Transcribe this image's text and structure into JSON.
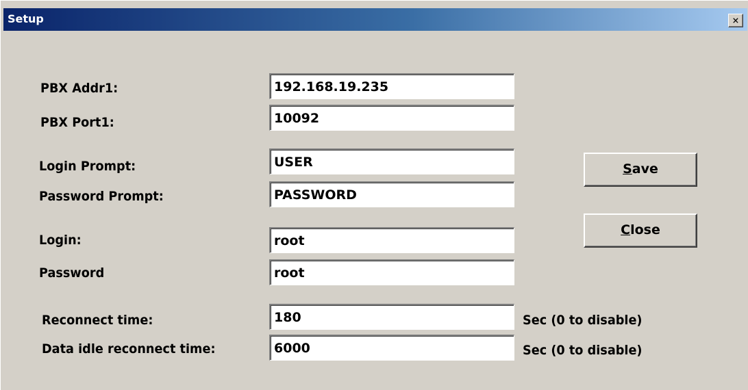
{
  "window": {
    "title": "Setup",
    "close_glyph": "×"
  },
  "fields": {
    "pbx_addr1": {
      "label": "PBX Addr1:",
      "value": "192.168.19.235"
    },
    "pbx_port1": {
      "label": "PBX Port1:",
      "value": "10092"
    },
    "login_prompt": {
      "label": "Login Prompt:",
      "value": "USER"
    },
    "password_prompt": {
      "label": "Password Prompt:",
      "value": "PASSWORD"
    },
    "login": {
      "label": "Login:",
      "value": "root"
    },
    "password": {
      "label": "Password",
      "value": "root"
    },
    "reconnect_time": {
      "label": "Reconnect time:",
      "value": "180",
      "unit": "Sec (0 to disable)"
    },
    "data_idle_reconnect_time": {
      "label": "Data idle reconnect time:",
      "value": "6000",
      "unit": "Sec (0 to disable)"
    }
  },
  "buttons": {
    "save": {
      "mnemonic": "S",
      "rest": "ave"
    },
    "close": {
      "mnemonic": "C",
      "rest": "lose"
    }
  },
  "colors": {
    "face": "#d4d0c8",
    "title_start": "#0a246a",
    "title_end": "#a6caf0"
  }
}
